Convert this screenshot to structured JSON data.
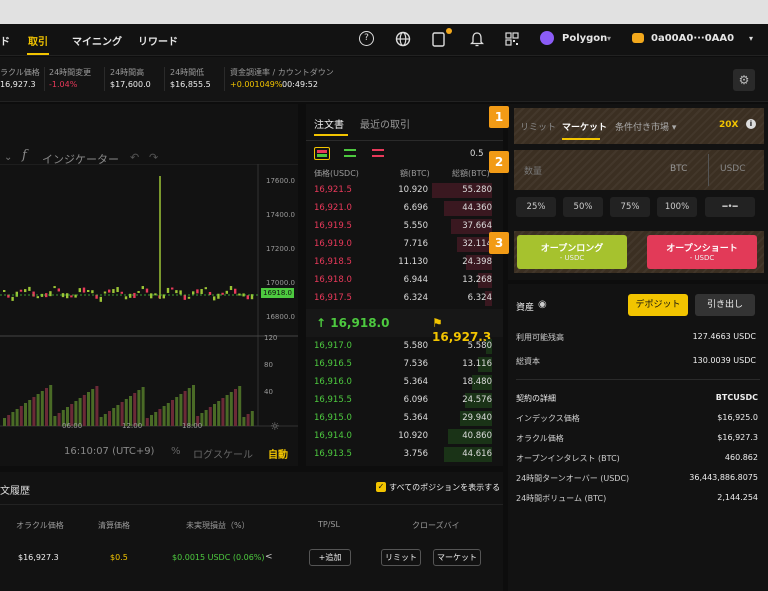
{
  "nav": {
    "partial_left": "ド",
    "trade": "取引",
    "mining": "マイニング",
    "reward": "リワード",
    "network": "Polygon",
    "account": "0a00A0···0AA0"
  },
  "stats": {
    "oracle_label": "ラクル価格",
    "oracle_value": "16,927.3",
    "change_label": "24時間変更",
    "change_value": "-1.04%",
    "high_label": "24時間高",
    "high_value": "$17,600.0",
    "low_label": "24時間低",
    "low_value": "$16,855.5",
    "funding_label": "資金調達率 / カウントダウン",
    "funding_rate": "+0.001049%",
    "funding_countdown": "00:49:52"
  },
  "chart": {
    "indicator_label": "インジケーター",
    "price_ticks": [
      "17600.0",
      "17400.0",
      "17200.0",
      "17000.0",
      "16800.0"
    ],
    "current_price": "16918.0",
    "volume_ticks": [
      "120",
      "80",
      "40"
    ],
    "time_ticks": [
      "06:00",
      "12:00",
      "18:00"
    ],
    "clock": "16:10:07 (UTC+9)",
    "percent": "%",
    "log_scale": "ログスケール",
    "auto": "自動"
  },
  "orderbook": {
    "tab_book": "注文書",
    "tab_trades": "最近の取引",
    "precision": "0.5",
    "headers": [
      "価格(USDC)",
      "額(BTC)",
      "総額(BTC)"
    ],
    "asks": [
      {
        "p": "16,921.5",
        "a": "10.920",
        "t": "55.280"
      },
      {
        "p": "16,921.0",
        "a": "6.696",
        "t": "44.360"
      },
      {
        "p": "16,919.5",
        "a": "5.550",
        "t": "37.664"
      },
      {
        "p": "16,919.0",
        "a": "7.716",
        "t": "32.114"
      },
      {
        "p": "16,918.5",
        "a": "11.130",
        "t": "24.398"
      },
      {
        "p": "16,918.0",
        "a": "6.944",
        "t": "13.268"
      },
      {
        "p": "16,917.5",
        "a": "6.324",
        "t": "6.324"
      }
    ],
    "last_price": "↑ 16,918.0",
    "mark_price": "⚑ 16,927.3",
    "bids": [
      {
        "p": "16,917.0",
        "a": "5.580",
        "t": "5.580"
      },
      {
        "p": "16,916.5",
        "a": "7.536",
        "t": "13.116"
      },
      {
        "p": "16,916.0",
        "a": "5.364",
        "t": "18.480"
      },
      {
        "p": "16,915.5",
        "a": "6.096",
        "t": "24.576"
      },
      {
        "p": "16,915.0",
        "a": "5.364",
        "t": "29.940"
      },
      {
        "p": "16,914.0",
        "a": "10.920",
        "t": "40.860"
      },
      {
        "p": "16,913.5",
        "a": "3.756",
        "t": "44.616"
      }
    ]
  },
  "order_form": {
    "tab_limit": "リミット",
    "tab_market": "マーケット",
    "tab_conditional": "条件付き市場 ▾",
    "leverage": "20X",
    "qty_placeholder": "数量",
    "unit_btc": "BTC",
    "unit_usdc": "USDC",
    "pcts": [
      "25%",
      "50%",
      "75%",
      "100%"
    ],
    "long_label": "オープンロング",
    "long_sub": "- USDC",
    "short_label": "オープンショート",
    "short_sub": "- USDC",
    "badges": [
      "1",
      "2",
      "3"
    ]
  },
  "assets": {
    "title": "資産",
    "deposit": "デポジット",
    "withdraw": "引き出し",
    "available_label": "利用可能残高",
    "available_value": "127.4663 USDC",
    "total_label": "総資本",
    "total_value": "130.0039 USDC"
  },
  "contract": {
    "rows": [
      {
        "k": "契約の詳細",
        "v": "BTCUSDC"
      },
      {
        "k": "インデックス価格",
        "v": "$16,925.0"
      },
      {
        "k": "オラクル価格",
        "v": "$16,927.3"
      },
      {
        "k": "オープンインタレスト (BTC)",
        "v": "460.862"
      },
      {
        "k": "24時間ターンオーバー (USDC)",
        "v": "36,443,886.8075"
      },
      {
        "k": "24時間ボリューム (BTC)",
        "v": "2,144.254"
      }
    ]
  },
  "positions": {
    "title": "文履歴",
    "show_all": "すべてのポジションを表示する",
    "headers": [
      "オラクル価格",
      "清算価格",
      "未実現損益（%）",
      "TP/SL",
      "クローズバイ"
    ],
    "row": {
      "oracle": "$16,927.3",
      "liq": "$0.5",
      "pnl": "$0.0015 USDC (0.06%)",
      "add": "+追加",
      "limit": "リミット",
      "market": "マーケット"
    }
  },
  "colors": {
    "accent": "#f2c400",
    "up": "#4dc93f",
    "down": "#e8395a",
    "badge": "#f29b16"
  }
}
